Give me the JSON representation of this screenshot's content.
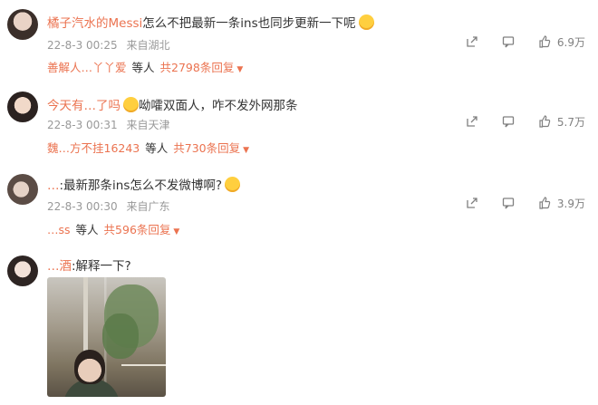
{
  "comments": [
    {
      "username": "橘子汽水的Messi",
      "text": "怎么不把最新一条ins也同步更新一下呢",
      "time": "22-8-3 00:25",
      "location": "来自湖北",
      "likes": "6.9万",
      "reply_preview": {
        "name": "善解人…丫丫爱",
        "deng": "等人",
        "more": "共2798条回复"
      }
    },
    {
      "username": "今天有…了吗",
      "text": "呦嚯双面人，咋不发外网那条",
      "time": "22-8-3 00:31",
      "location": "来自天津",
      "likes": "5.7万",
      "reply_preview": {
        "name": "魏…方不挂16243",
        "deng": "等人",
        "more": "共730条回复"
      }
    },
    {
      "username": "…",
      "text": ":最新那条ins怎么不发微博啊?",
      "time": "22-8-3 00:30",
      "location": "来自广东",
      "likes": "3.9万",
      "reply_preview": {
        "name": "…ss",
        "deng": "等人",
        "more": "共596条回复"
      }
    },
    {
      "username": "…酒",
      "text": ":解释一下?",
      "has_image": true
    }
  ],
  "icons": {
    "share": "share-icon",
    "comment": "comment-icon",
    "like": "thumbs-up-icon",
    "caret": "▼"
  },
  "colors": {
    "accent": "#eb7350",
    "meta": "#999999"
  }
}
